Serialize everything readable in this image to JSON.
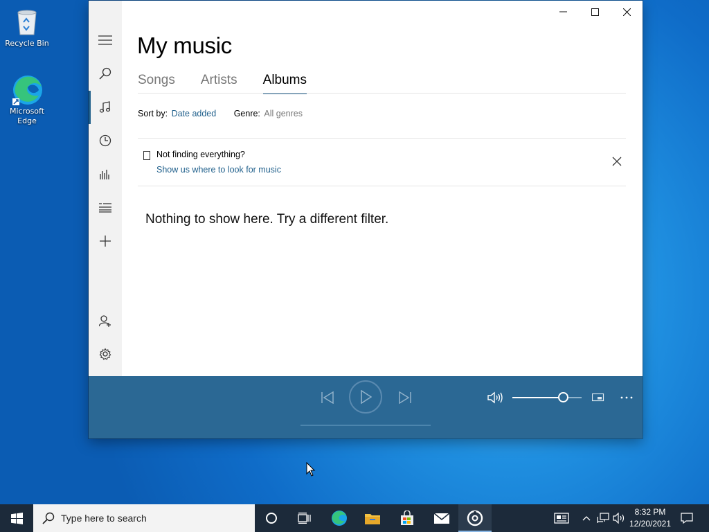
{
  "desktop": {
    "icons": [
      {
        "label": "Recycle Bin"
      },
      {
        "label": "Microsoft Edge"
      }
    ]
  },
  "window": {
    "title_buttons": {
      "minimize": "minimize-icon",
      "maximize": "maximize-icon",
      "close": "close-icon"
    },
    "nav": [
      "hamburger-icon",
      "search-icon",
      "music-note-icon",
      "clock-icon",
      "bar-chart-icon",
      "playlist-icon",
      "plus-icon",
      "add-user-icon",
      "gear-icon"
    ],
    "page_title": "My music",
    "tabs": [
      {
        "label": "Songs",
        "active": false
      },
      {
        "label": "Artists",
        "active": false
      },
      {
        "label": "Albums",
        "active": true
      }
    ],
    "filters": {
      "sort_label": "Sort by:",
      "sort_value": "Date added",
      "genre_label": "Genre:",
      "genre_value": "All genres"
    },
    "notice": {
      "question": "Not finding everything?",
      "link": "Show us where to look for music"
    },
    "empty_message": "Nothing to show here. Try a different filter.",
    "player": {
      "volume_level": 0.72,
      "accent": "#2b6894"
    }
  },
  "taskbar": {
    "search_placeholder": "Type here to search",
    "time": "8:32 PM",
    "date": "12/20/2021",
    "background": "#1c2a3a"
  },
  "colors": {
    "accent": "#1f5f8b",
    "desktop": "#1f8fe0"
  }
}
